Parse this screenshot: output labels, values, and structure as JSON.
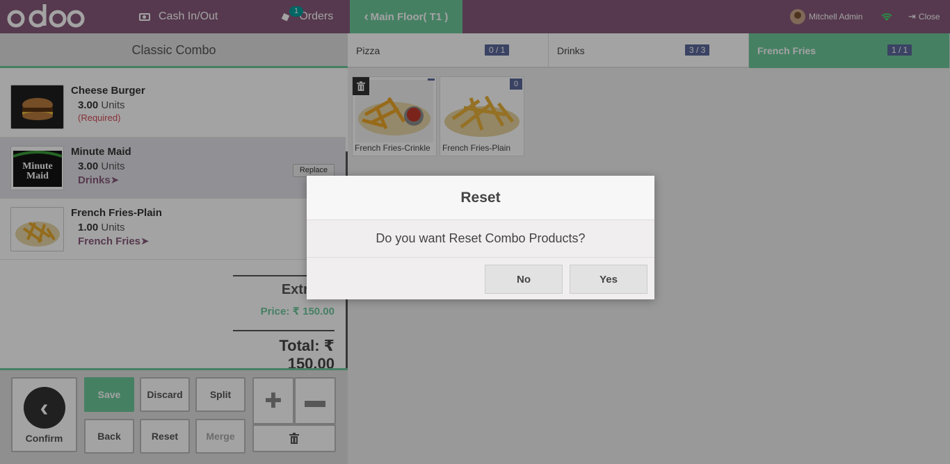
{
  "topbar": {
    "cash_label": "Cash In/Out",
    "orders_label": "Orders",
    "orders_count": "1",
    "floor_label": "Main Floor( T1 )",
    "user_name": "Mitchell Admin",
    "close_label": "Close",
    "brand_color": "#875a7b"
  },
  "combo": {
    "title": "Classic Combo",
    "lines": [
      {
        "name": "Cheese Burger",
        "qty": "3.00",
        "unit": "Units",
        "note": "(Required)"
      },
      {
        "name": "Minute Maid",
        "qty": "3.00",
        "unit": "Units",
        "category": "Drinks",
        "replace_label": "Replace"
      },
      {
        "name": "French Fries-Plain",
        "qty": "1.00",
        "unit": "Units",
        "category": "French Fries"
      }
    ],
    "extra": "Extra: ₹",
    "price": "Price: ₹ 150.00",
    "total": "Total: ₹ 150.00"
  },
  "pad": {
    "confirm": "Confirm",
    "save": "Save",
    "discard": "Discard",
    "split": "Split",
    "back": "Back",
    "reset": "Reset",
    "merge": "Merge"
  },
  "tabs": [
    {
      "label": "Pizza",
      "count": "0 / 1"
    },
    {
      "label": "Drinks",
      "count": "3 / 3"
    },
    {
      "label": "French Fries",
      "count": "1 / 1"
    }
  ],
  "products": [
    {
      "name": "French Fries-Crinkle",
      "badge": ""
    },
    {
      "name": "French Fries-Plain",
      "badge": "0"
    }
  ],
  "modal": {
    "title": "Reset",
    "message": "Do you want Reset Combo Products?",
    "no": "No",
    "yes": "Yes"
  },
  "colors": {
    "accent": "#6ec89b",
    "badge": "#5c6a9c"
  }
}
